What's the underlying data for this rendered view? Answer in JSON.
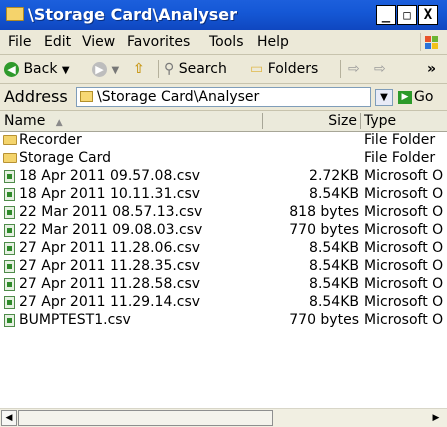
{
  "window": {
    "title": "\\Storage Card\\Analyser",
    "minimize": "_",
    "restore": "□",
    "close": "X"
  },
  "menu": [
    "File",
    "Edit",
    "View",
    "Favorites",
    "Tools",
    "Help"
  ],
  "toolbar": {
    "back": "Back",
    "search": "Search",
    "folders": "Folders"
  },
  "address": {
    "label": "Address",
    "value": "\\Storage Card\\Analyser",
    "go": "Go"
  },
  "columns": {
    "name": "Name",
    "size": "Size",
    "type": "Type"
  },
  "rows": [
    {
      "name": "Recorder",
      "size": "",
      "type": "File Folder",
      "icon": "folder"
    },
    {
      "name": "Storage Card",
      "size": "",
      "type": "File Folder",
      "icon": "folder"
    },
    {
      "name": "18 Apr 2011 09.57.08.csv",
      "size": "2.72KB",
      "type": "Microsoft O",
      "icon": "csv"
    },
    {
      "name": "18 Apr 2011 10.11.31.csv",
      "size": "8.54KB",
      "type": "Microsoft O",
      "icon": "csv"
    },
    {
      "name": "22 Mar 2011 08.57.13.csv",
      "size": "818 bytes",
      "type": "Microsoft O",
      "icon": "csv"
    },
    {
      "name": "22 Mar 2011 09.08.03.csv",
      "size": "770 bytes",
      "type": "Microsoft O",
      "icon": "csv"
    },
    {
      "name": "27 Apr 2011 11.28.06.csv",
      "size": "8.54KB",
      "type": "Microsoft O",
      "icon": "csv"
    },
    {
      "name": "27 Apr 2011 11.28.35.csv",
      "size": "8.54KB",
      "type": "Microsoft O",
      "icon": "csv"
    },
    {
      "name": "27 Apr 2011 11.28.58.csv",
      "size": "8.54KB",
      "type": "Microsoft O",
      "icon": "csv"
    },
    {
      "name": "27 Apr 2011 11.29.14.csv",
      "size": "8.54KB",
      "type": "Microsoft O",
      "icon": "csv"
    },
    {
      "name": "BUMPTEST1.csv",
      "size": "770 bytes",
      "type": "Microsoft O",
      "icon": "csv"
    }
  ]
}
